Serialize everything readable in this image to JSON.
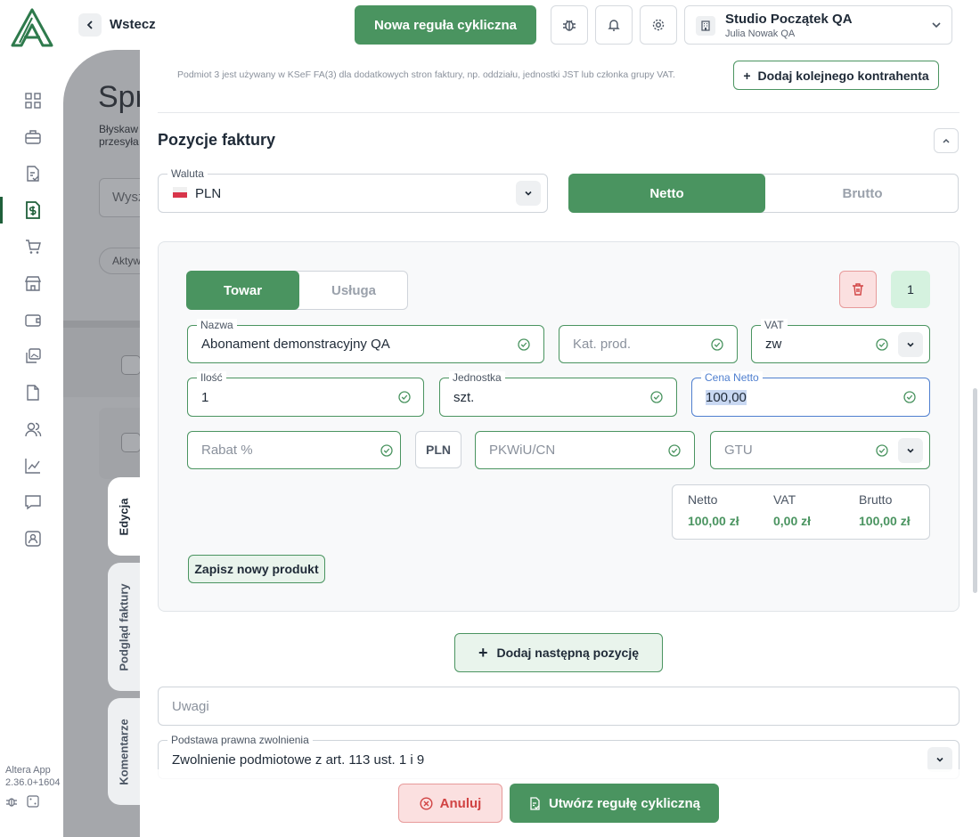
{
  "header": {
    "back_label": "Wstecz",
    "new_rule_label": "Nowa reguła cykliczna",
    "company_name": "Studio Początek QA",
    "company_user": "Julia Nowak QA"
  },
  "sidebar": {
    "app_name": "Altera App",
    "app_version": "2.36.0+1604"
  },
  "background": {
    "title": "Spr",
    "subtitle_line1": "Błyskaw",
    "subtitle_line2": "przesyła",
    "search_placeholder": "Wysz",
    "chip_label": "Aktyw"
  },
  "side_tabs": {
    "edit": "Edycja",
    "preview": "Podgląd faktury",
    "comments": "Komentarze"
  },
  "panel": {
    "subject3_note": "Podmiot 3 jest używany w KSeF FA(3) dla dodatkowych stron faktury, np. oddziału, jednostki JST lub członka grupy VAT.",
    "add_contractor_label": "Dodaj kolejnego kontrahenta",
    "section_title": "Pozycje faktury",
    "currency": {
      "label": "Waluta",
      "value": "PLN"
    },
    "price_mode": {
      "netto": "Netto",
      "brutto": "Brutto",
      "selected": "netto"
    },
    "item": {
      "type_towar": "Towar",
      "type_usluga": "Usługa",
      "selected_type": "towar",
      "index": "1",
      "name": {
        "label": "Nazwa",
        "value": "Abonament demonstracyjny QA"
      },
      "category": {
        "placeholder": "Kat. prod."
      },
      "vat": {
        "label": "VAT",
        "value": "zw"
      },
      "quantity": {
        "label": "Ilość",
        "value": "1"
      },
      "unit": {
        "label": "Jednostka",
        "value": "szt."
      },
      "net_price": {
        "label": "Cena Netto",
        "value": "100,00"
      },
      "discount": {
        "placeholder": "Rabat %"
      },
      "discount_currency": "PLN",
      "pkwiu": {
        "placeholder": "PKWiU/CN"
      },
      "gtu": {
        "placeholder": "GTU"
      },
      "totals": {
        "netto_label": "Netto",
        "netto_value": "100,00 zł",
        "vat_label": "VAT",
        "vat_value": "0,00 zł",
        "brutto_label": "Brutto",
        "brutto_value": "100,00 zł"
      },
      "save_product_label": "Zapisz nowy produkt"
    },
    "add_next_label": "Dodaj następną pozycję",
    "notes_placeholder": "Uwagi",
    "exemption": {
      "label": "Podstawa prawna zwolnienia",
      "value": "Zwolnienie podmiotowe z art. 113 ust. 1 i 9"
    }
  },
  "footer": {
    "cancel_label": "Anuluj",
    "create_label": "Utwórz regułę cykliczną"
  },
  "colors": {
    "accent": "#4a9460",
    "danger": "#d14343",
    "focus": "#4f7fcf"
  }
}
